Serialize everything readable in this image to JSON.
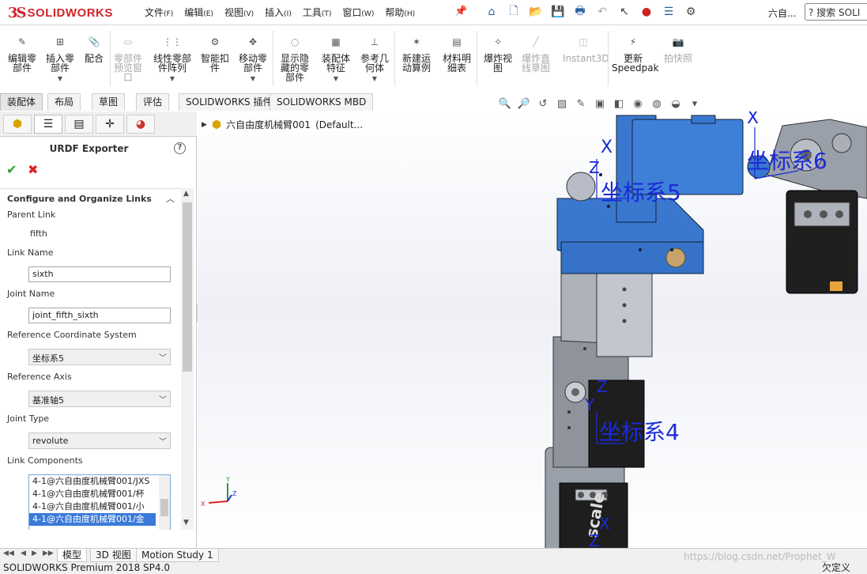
{
  "app": {
    "logo_ds": "3S",
    "logo_text": "SOLIDWORKS",
    "doc_title": "六自...",
    "search_placeholder": "搜索 SOLI"
  },
  "menu": [
    {
      "label": "文件",
      "key": "(F)"
    },
    {
      "label": "编辑",
      "key": "(E)"
    },
    {
      "label": "视图",
      "key": "(V)"
    },
    {
      "label": "插入",
      "key": "(I)"
    },
    {
      "label": "工具",
      "key": "(T)"
    },
    {
      "label": "窗口",
      "key": "(W)"
    },
    {
      "label": "帮助",
      "key": "(H)"
    }
  ],
  "ribbon": [
    {
      "l1": "编辑零",
      "l2": "部件",
      "l3": "",
      "disabled": false
    },
    {
      "l1": "插入零",
      "l2": "部件",
      "l3": "",
      "disabled": false,
      "arrow": true
    },
    {
      "l1": "配合",
      "l2": "",
      "l3": "",
      "disabled": false
    },
    {
      "l1": "零部件",
      "l2": "预览窗",
      "l3": "口",
      "disabled": true
    },
    {
      "l1": "线性零部",
      "l2": "件阵列",
      "l3": "",
      "disabled": false,
      "arrow": true
    },
    {
      "l1": "智能扣",
      "l2": "件",
      "l3": "",
      "disabled": false
    },
    {
      "l1": "移动零",
      "l2": "部件",
      "l3": "",
      "disabled": false,
      "arrow": true
    },
    {
      "l1": "显示隐",
      "l2": "藏的零",
      "l3": "部件",
      "disabled": false
    },
    {
      "l1": "装配体",
      "l2": "特征",
      "l3": "",
      "disabled": false,
      "arrow": true
    },
    {
      "l1": "参考几",
      "l2": "何体",
      "l3": "",
      "disabled": false,
      "arrow": true
    },
    {
      "l1": "新建运",
      "l2": "动算例",
      "l3": "",
      "disabled": false
    },
    {
      "l1": "材料明",
      "l2": "细表",
      "l3": "",
      "disabled": false
    },
    {
      "l1": "爆炸视",
      "l2": "图",
      "l3": "",
      "disabled": false
    },
    {
      "l1": "爆炸直",
      "l2": "线草图",
      "l3": "",
      "disabled": true
    },
    {
      "l1": "Instant3D",
      "l2": "",
      "l3": "",
      "disabled": true
    },
    {
      "l1": "更新",
      "l2": "Speedpak",
      "l3": "",
      "disabled": false
    },
    {
      "l1": "拍快照",
      "l2": "",
      "l3": "",
      "disabled": true
    }
  ],
  "tabs": [
    "装配体",
    "布局",
    "草图",
    "评估",
    "SOLIDWORKS 插件",
    "SOLIDWORKS MBD"
  ],
  "panel": {
    "title": "URDF Exporter",
    "group_title": "Configure and Organize Links",
    "parent_link_label": "Parent Link",
    "parent_link_value": "fifth",
    "link_name_label": "Link Name",
    "link_name_value": "sixth",
    "joint_name_label": "Joint Name",
    "joint_name_value": "joint_fifth_sixth",
    "ref_coord_label": "Reference Coordinate System",
    "ref_coord_value": "坐标系5",
    "ref_axis_label": "Reference Axis",
    "ref_axis_value": "基准轴5",
    "joint_type_label": "Joint Type",
    "joint_type_value": "revolute",
    "link_components_label": "Link Components",
    "link_components": [
      "4-1@六自由度机械臂001/JXS",
      "4-1@六自由度机械臂001/杯",
      "4-1@六自由度机械臂001/小",
      "4-1@六自由度机械臂001/金"
    ],
    "selected_component_index": 3
  },
  "tree": {
    "root_label": "六自由度机械臂001",
    "config": "(Default..."
  },
  "scene": {
    "labels": [
      {
        "text": "坐标系5"
      },
      {
        "text": "坐标系6"
      },
      {
        "text": "坐标系4"
      }
    ],
    "axis_x": "X",
    "axis_y": "Y",
    "axis_z": "Z",
    "part_label": "scale",
    "colors": {
      "blue_part": "#3a78d0",
      "metal": "#b8bcc6",
      "dark": "#2a2a2a",
      "axis_label": "#1a2bd6"
    }
  },
  "bottom_tabs": [
    "模型",
    "3D 视图",
    "Motion Study 1"
  ],
  "watermark": "https://blog.csdn.net/Prophet_W",
  "status": {
    "left": "SOLIDWORKS Premium 2018 SP4.0",
    "right": "欠定义"
  }
}
